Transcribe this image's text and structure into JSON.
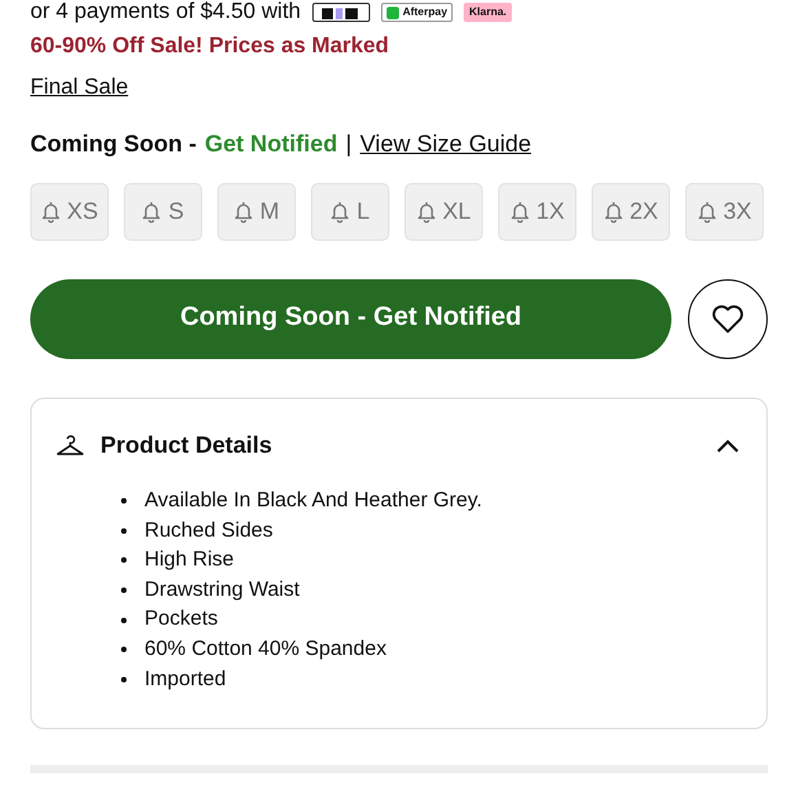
{
  "payment": {
    "text": "or 4 payments of $4.50 with",
    "badges": [
      {
        "kind": "zip"
      },
      {
        "kind": "afterpay",
        "label": "Afterpay"
      },
      {
        "kind": "klarna",
        "label": "Klarna."
      }
    ]
  },
  "sale_notice": "60-90% Off Sale! Prices as Marked",
  "final_sale_link": "Final Sale",
  "availability": {
    "status": "Coming Soon -",
    "action": "Get Notified",
    "separator": "|",
    "size_guide_link": "View Size Guide"
  },
  "sizes": [
    "XS",
    "S",
    "M",
    "L",
    "XL",
    "1X",
    "2X",
    "3X"
  ],
  "notify_button": "Coming Soon - Get Notified",
  "product_details": {
    "title": "Product Details",
    "expanded": true,
    "items": [
      "Available In Black And Heather Grey.",
      "Ruched Sides",
      "High Rise",
      "Drawstring Waist",
      "Pockets",
      "60% Cotton 40% Spandex",
      "Imported"
    ]
  }
}
